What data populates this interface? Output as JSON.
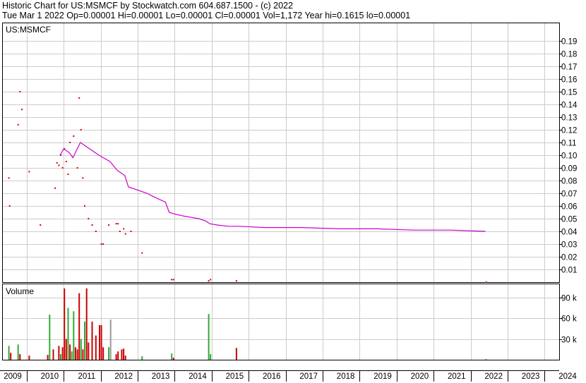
{
  "header": {
    "line1": "Historic Chart for US:MSMCF by Stockwatch.com 604.687.1500 - (c) 2022",
    "line2": "Tue Mar  1 2022   Op=0.00001   Hi=0.00001   Lo=0.00001   Cl=0.00001   Vol=1,172   Year hi=0.1615   lo=0.00001"
  },
  "colors": {
    "price_bar": "#000000",
    "price_dot": "#cc0000",
    "moving_average": "#cc00cc",
    "volume_up": "#33aa33",
    "volume_down": "#cc0000",
    "volume_flat": "#999999",
    "grid": "#cccccc"
  },
  "chart_data": [
    {
      "type": "line",
      "panel": "price",
      "title": "US:MSMCF",
      "ylim": [
        0,
        0.2
      ],
      "y_ticks": [
        "0.01",
        "0.02",
        "0.03",
        "0.04",
        "0.05",
        "0.06",
        "0.07",
        "0.08",
        "0.09",
        "0.10",
        "0.11",
        "0.12",
        "0.13",
        "0.14",
        "0.15",
        "0.16",
        "0.17",
        "0.18",
        "0.19"
      ],
      "x_ticks": [
        "2009",
        "2010",
        "2011",
        "2012",
        "2013",
        "2014",
        "2015",
        "2016",
        "2017",
        "2018",
        "2019",
        "2020",
        "2021",
        "2022",
        "2023",
        "2024"
      ],
      "grid": true,
      "series": [
        {
          "role": "moving_average",
          "x": [
            2010.45,
            2010.55,
            2010.7,
            2010.8,
            2011.0,
            2011.3,
            2011.5,
            2011.8,
            2012.0,
            2012.2,
            2012.3,
            2012.5,
            2012.8,
            2013.0,
            2013.3,
            2013.4,
            2013.5,
            2013.8,
            2014.0,
            2014.2,
            2014.4,
            2014.5,
            2014.7,
            2015.0,
            2015.3,
            2016.0,
            2016.5,
            2017.0,
            2018.0,
            2019.0,
            2020.0,
            2021.0,
            2021.95
          ],
          "y": [
            0.1,
            0.105,
            0.102,
            0.098,
            0.11,
            0.104,
            0.1,
            0.095,
            0.088,
            0.084,
            0.075,
            0.073,
            0.07,
            0.067,
            0.063,
            0.055,
            0.054,
            0.052,
            0.051,
            0.05,
            0.048,
            0.046,
            0.045,
            0.044,
            0.044,
            0.043,
            0.043,
            0.043,
            0.042,
            0.042,
            0.041,
            0.041,
            0.04
          ]
        },
        {
          "role": "price",
          "x": [
            2009.05,
            2009.07,
            2009.3,
            2009.35,
            2009.4,
            2009.6,
            2009.9,
            2010.3,
            2010.35,
            2010.4,
            2010.45,
            2010.5,
            2010.55,
            2010.6,
            2010.65,
            2010.7,
            2010.8,
            2010.9,
            2010.95,
            2011.0,
            2011.05,
            2011.1,
            2011.2,
            2011.3,
            2011.4,
            2011.55,
            2011.6,
            2011.75,
            2011.95,
            2012.0,
            2012.05,
            2012.15,
            2012.2,
            2012.35,
            2012.65,
            2013.45,
            2013.5,
            2014.45,
            2014.5,
            2015.2,
            2021.95
          ],
          "y": [
            0.082,
            0.06,
            0.124,
            0.15,
            0.136,
            0.087,
            0.045,
            0.074,
            0.094,
            0.092,
            0.1,
            0.09,
            0.105,
            0.095,
            0.085,
            0.11,
            0.115,
            0.09,
            0.145,
            0.12,
            0.082,
            0.06,
            0.05,
            0.045,
            0.04,
            0.03,
            0.03,
            0.045,
            0.046,
            0.046,
            0.04,
            0.042,
            0.038,
            0.04,
            0.023,
            0.002,
            0.002,
            0.001,
            0.002,
            0.001,
            1e-05
          ]
        }
      ]
    },
    {
      "type": "bar",
      "panel": "volume",
      "title": "Volume",
      "ylim": [
        0,
        110000
      ],
      "y_ticks": [
        "30 k",
        "60 k",
        "90 k"
      ],
      "x_ticks": [
        "2009",
        "2010",
        "2011",
        "2012",
        "2013",
        "2014",
        "2015",
        "2016",
        "2017",
        "2018",
        "2019",
        "2020",
        "2021",
        "2022",
        "2023",
        "2024"
      ],
      "grid": true,
      "x": [
        2009.05,
        2009.1,
        2009.3,
        2009.35,
        2009.6,
        2010.1,
        2010.15,
        2010.25,
        2010.4,
        2010.45,
        2010.5,
        2010.55,
        2010.6,
        2010.65,
        2010.7,
        2010.75,
        2010.8,
        2010.85,
        2010.9,
        2010.95,
        2011.0,
        2011.05,
        2011.1,
        2011.15,
        2011.2,
        2011.3,
        2011.4,
        2011.5,
        2011.55,
        2011.6,
        2011.75,
        2011.8,
        2011.95,
        2012.0,
        2012.1,
        2012.15,
        2012.2,
        2012.65,
        2013.45,
        2013.5,
        2014.45,
        2014.5,
        2015.2,
        2021.95
      ],
      "values": [
        20000,
        10000,
        22000,
        8000,
        6000,
        7000,
        65000,
        15000,
        20000,
        8000,
        18000,
        103000,
        30000,
        75000,
        22000,
        12000,
        70000,
        18000,
        15000,
        96000,
        30000,
        15000,
        55000,
        103000,
        25000,
        55000,
        35000,
        50000,
        50000,
        18000,
        18000,
        58000,
        8000,
        12000,
        15000,
        16000,
        6000,
        5000,
        9000,
        3000,
        66000,
        8000,
        17000,
        1172
      ],
      "colors": [
        "green",
        "red",
        "green",
        "red",
        "red",
        "red",
        "green",
        "red",
        "red",
        "green",
        "red",
        "red",
        "red",
        "green",
        "red",
        "green",
        "green",
        "red",
        "red",
        "red",
        "green",
        "red",
        "green",
        "red",
        "red",
        "red",
        "red",
        "red",
        "red",
        "red",
        "green",
        "gray",
        "red",
        "red",
        "red",
        "red",
        "red",
        "green",
        "green",
        "red",
        "green",
        "green",
        "red",
        "gray"
      ]
    }
  ]
}
